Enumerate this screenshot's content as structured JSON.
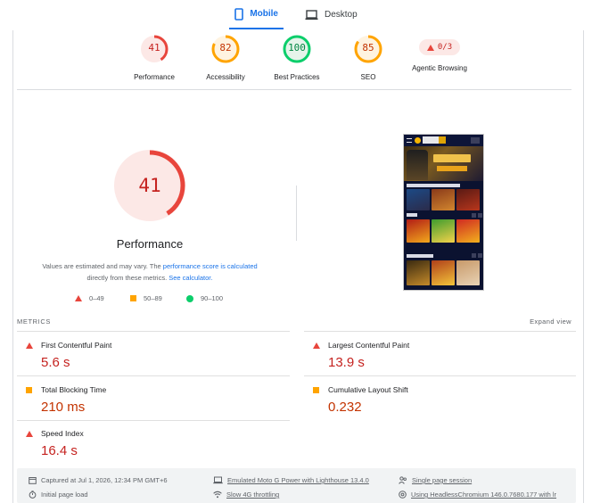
{
  "tabs": [
    {
      "label": "Mobile",
      "active": true
    },
    {
      "label": "Desktop",
      "active": false
    }
  ],
  "categories": [
    {
      "score": "41",
      "label": "Performance",
      "fraction": 0.41,
      "color": "#e8453c",
      "bg": "#fce8e6",
      "text": "#c5221f"
    },
    {
      "score": "82",
      "label": "Accessibility",
      "fraction": 0.82,
      "color": "#ffa400",
      "bg": "#fff3e0",
      "text": "#c33300"
    },
    {
      "score": "100",
      "label": "Best Practices",
      "fraction": 1.0,
      "color": "#0cce6b",
      "bg": "#e6f4ea",
      "text": "#018642"
    },
    {
      "score": "85",
      "label": "SEO",
      "fraction": 0.85,
      "color": "#ffa400",
      "bg": "#fff3e0",
      "text": "#c33300"
    }
  ],
  "agentic": {
    "score": "0/3",
    "label": "Agentic Browsing"
  },
  "performance": {
    "score": "41",
    "fraction": 0.41,
    "title": "Performance",
    "note_prefix": "Values are estimated and may vary. The ",
    "note_link1": "performance score is calculated",
    "note_middle": "directly from these metrics. ",
    "note_link2": "See calculator."
  },
  "legend": [
    {
      "range": "0–49",
      "shape": "triangle",
      "color": "#e8453c"
    },
    {
      "range": "50–89",
      "shape": "square",
      "color": "#ffa400"
    },
    {
      "range": "90–100",
      "shape": "circle",
      "color": "#0cce6b"
    }
  ],
  "metrics": {
    "header": "METRICS",
    "expand": "Expand view",
    "items": [
      {
        "label": "First Contentful Paint",
        "value": "5.6 s",
        "status": "poor"
      },
      {
        "label": "Largest Contentful Paint",
        "value": "13.9 s",
        "status": "poor"
      },
      {
        "label": "Total Blocking Time",
        "value": "210 ms",
        "status": "average"
      },
      {
        "label": "Cumulative Layout Shift",
        "value": "0.232",
        "status": "average"
      },
      {
        "label": "Speed Index",
        "value": "16.4 s",
        "status": "poor"
      }
    ]
  },
  "footer": {
    "captured": "Captured at Jul 1, 2026, 12:34 PM GMT+6",
    "initial": "Initial page load",
    "device": "Emulated Moto G Power with Lighthouse 13.4.0",
    "throttling": "Slow 4G throttling",
    "session": "Single page session",
    "browser": "Using HeadlessChromium 146.0.7680.177 with lr"
  },
  "colors": {
    "accent": "#1a73e8",
    "fail": "#e8453c",
    "average": "#ffa400",
    "pass": "#0cce6b"
  }
}
